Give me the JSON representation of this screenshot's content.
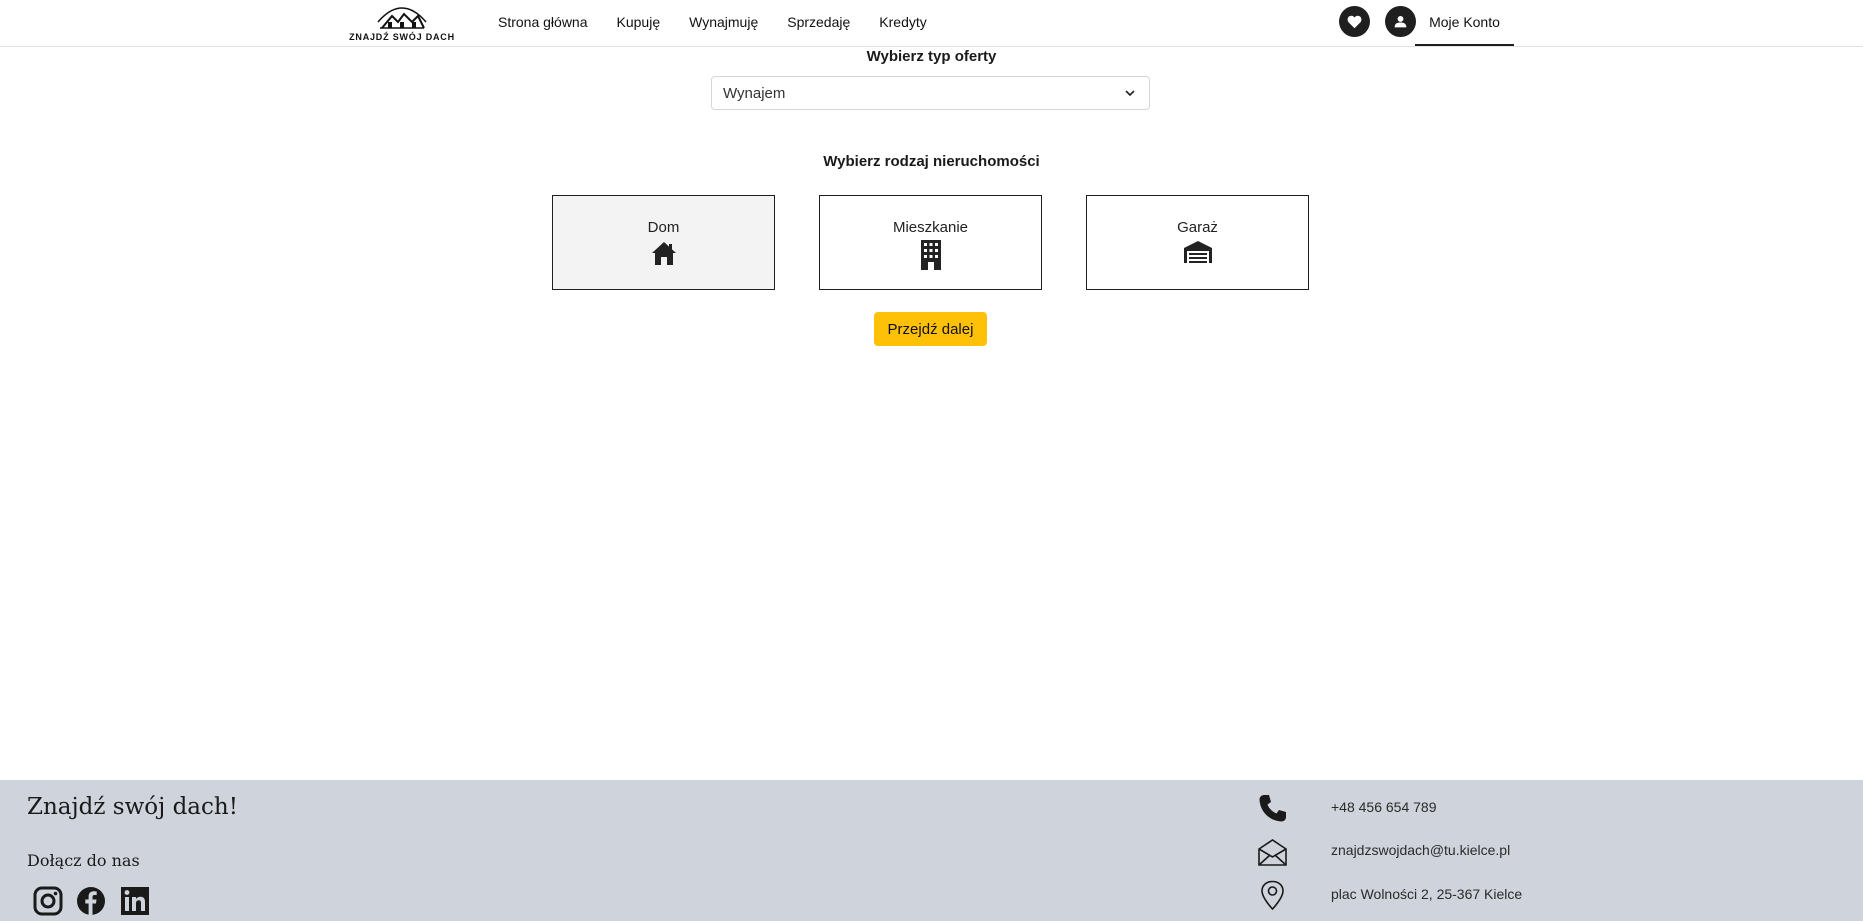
{
  "brand": {
    "logo_text": "ZNAJDŹ SWÓJ DACH"
  },
  "nav": {
    "items": [
      {
        "label": "Strona główna"
      },
      {
        "label": "Kupuję"
      },
      {
        "label": "Wynajmuję"
      },
      {
        "label": "Sprzedaję"
      },
      {
        "label": "Kredyty"
      }
    ],
    "favorites_icon": "heart-icon",
    "user_icon": "user-icon",
    "account_label": "Moje Konto"
  },
  "offer": {
    "heading": "Wybierz typ oferty",
    "selected": "Wynajem"
  },
  "property": {
    "heading": "Wybierz rodzaj nieruchomości",
    "options": [
      {
        "label": "Dom",
        "icon": "house-icon",
        "selected": true
      },
      {
        "label": "Mieszkanie",
        "icon": "building-icon",
        "selected": false
      },
      {
        "label": "Garaż",
        "icon": "garage-icon",
        "selected": false
      }
    ],
    "next_label": "Przejdź dalej"
  },
  "footer": {
    "title": "Znajdź swój dach!",
    "join_label": "Dołącz do nas",
    "social": [
      "instagram-icon",
      "facebook-icon",
      "linkedin-icon"
    ],
    "phone": "+48 456 654 789",
    "email": "znajdzswojdach@tu.kielce.pl",
    "address": "plac Wolności 2, 25-367 Kielce"
  },
  "colors": {
    "accent": "#ffc107",
    "footer_bg": "#cfd4dc",
    "dark": "#1f1f1f"
  }
}
